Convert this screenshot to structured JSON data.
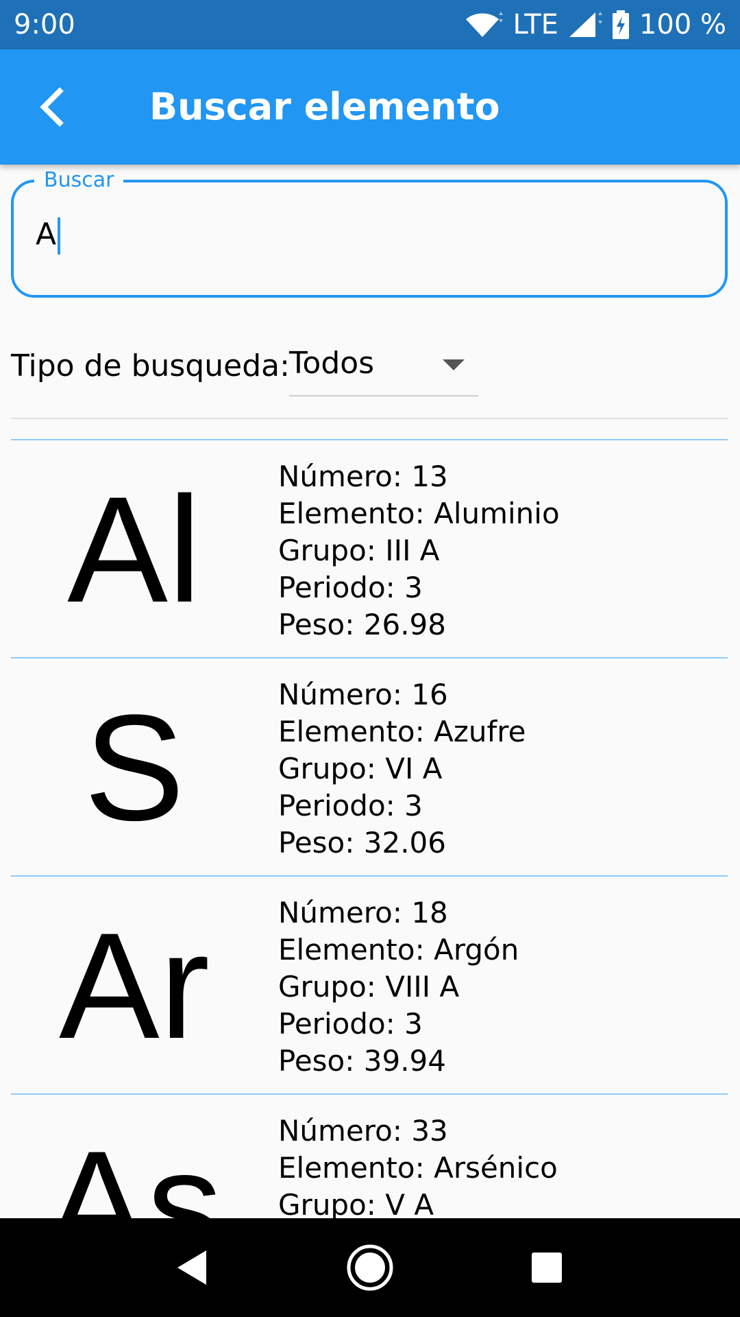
{
  "status_bar": {
    "time": "9:00",
    "network": "LTE",
    "battery": "100 %"
  },
  "app_bar": {
    "title": "Buscar elemento"
  },
  "search": {
    "label": "Buscar",
    "value": "A"
  },
  "filter": {
    "label": "Tipo de busqueda:",
    "selected": "Todos"
  },
  "results": [
    {
      "symbol": "Al",
      "numero": "Número: 13",
      "elemento": "Elemento: Aluminio",
      "grupo": "Grupo: III A",
      "periodo": "Periodo: 3",
      "peso": "Peso: 26.98"
    },
    {
      "symbol": "S",
      "numero": "Número: 16",
      "elemento": "Elemento: Azufre",
      "grupo": "Grupo: VI A",
      "periodo": "Periodo: 3",
      "peso": "Peso: 32.06"
    },
    {
      "symbol": "Ar",
      "numero": "Número: 18",
      "elemento": "Elemento: Argón",
      "grupo": "Grupo: VIII A",
      "periodo": "Periodo: 3",
      "peso": "Peso: 39.94"
    },
    {
      "symbol": "As",
      "numero": "Número: 33",
      "elemento": "Elemento: Arsénico",
      "grupo": "Grupo: V A",
      "periodo": "",
      "peso": ""
    }
  ],
  "icons": {
    "back": "chevron-left-icon",
    "nav_back": "triangle-back-icon",
    "nav_home": "circle-home-icon",
    "nav_recents": "square-recents-icon"
  },
  "colors": {
    "status_bar": "#1e70b7",
    "app_bar": "#2196f3",
    "accent": "#2196f3",
    "divider": "#90caf9"
  }
}
